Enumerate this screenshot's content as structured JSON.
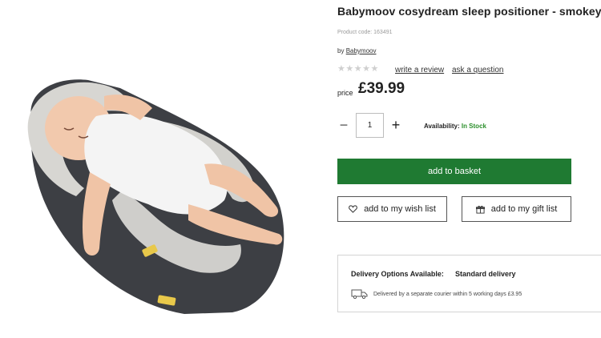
{
  "product": {
    "title": "Babymoov cosydream sleep positioner - smokey",
    "code": "Product code: 163491",
    "by_prefix": "by",
    "brand": "Babymoov",
    "image_alt": "Babymoov cosydream sleep positioner with baby"
  },
  "rating": {
    "stars": "★★★★★",
    "star_color": "#cfcfcf",
    "write_review": "write a review",
    "ask_question": "ask a question"
  },
  "price": {
    "label": "price",
    "value": "£39.99"
  },
  "quantity": {
    "minus": "−",
    "value": "1",
    "plus": "+"
  },
  "availability": {
    "label": "Availability:",
    "status": "In Stock",
    "status_color": "#2b8f2b"
  },
  "actions": {
    "add_to_basket": "add to basket",
    "basket_color": "#1f7a32",
    "wish_list": "add to my wish list",
    "gift_list": "add to my gift list",
    "wish_icon": "heart-icon",
    "gift_icon": "gift-icon"
  },
  "delivery": {
    "title": "Delivery Options Available:",
    "option": "Standard delivery",
    "note": "Delivered by a separate courier within 5 working days £3.95",
    "icon": "van-icon"
  }
}
